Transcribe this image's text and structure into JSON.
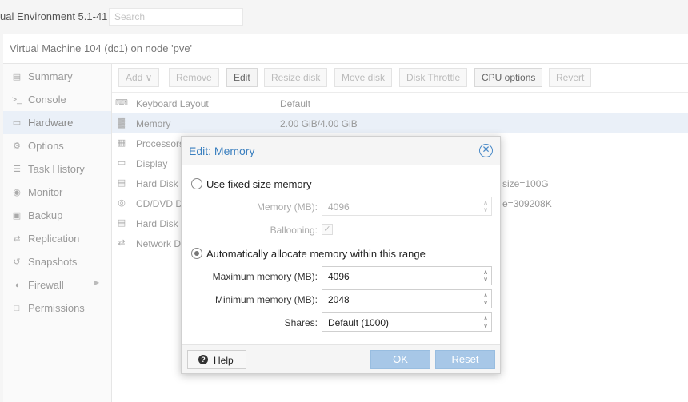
{
  "app": {
    "title": "ual Environment 5.1-41",
    "search_placeholder": "Search"
  },
  "panel": {
    "title": "Virtual Machine 104 (dc1) on node 'pve'"
  },
  "sidebar": {
    "items": [
      {
        "label": "Summary",
        "icon": "summary-icon",
        "glyph": "▤",
        "active": false
      },
      {
        "label": "Console",
        "icon": "console-icon",
        "glyph": ">_",
        "active": false
      },
      {
        "label": "Hardware",
        "icon": "monitor-icon",
        "glyph": "▭",
        "active": true
      },
      {
        "label": "Options",
        "icon": "gear-icon",
        "glyph": "⚙",
        "active": false
      },
      {
        "label": "Task History",
        "icon": "list-icon",
        "glyph": "☰",
        "active": false
      },
      {
        "label": "Monitor",
        "icon": "eye-icon",
        "glyph": "◉",
        "active": false
      },
      {
        "label": "Backup",
        "icon": "floppy-icon",
        "glyph": "▣",
        "active": false
      },
      {
        "label": "Replication",
        "icon": "retweet-icon",
        "glyph": "⇄",
        "active": false
      },
      {
        "label": "Snapshots",
        "icon": "history-icon",
        "glyph": "↺",
        "active": false
      },
      {
        "label": "Firewall",
        "icon": "shield-icon",
        "glyph": "◖",
        "active": false,
        "has_arrow": true
      },
      {
        "label": "Permissions",
        "icon": "unlock-icon",
        "glyph": "□",
        "active": false
      }
    ],
    "arrow_glyph": "▶"
  },
  "toolbar": {
    "add": "Add ∨",
    "remove": "Remove",
    "edit": "Edit",
    "resize_disk": "Resize disk",
    "move_disk": "Move disk",
    "disk_throttle": "Disk Throttle",
    "cpu_options": "CPU options",
    "revert": "Revert"
  },
  "hardware": {
    "rows": [
      {
        "name": "Keyboard Layout",
        "value": "Default",
        "tail": "",
        "icon": "keyboard-icon",
        "glyph": "⌨"
      },
      {
        "name": "Memory",
        "value": "2.00 GiB/4.00 GiB",
        "tail": "",
        "icon": "memory-icon",
        "glyph": "▓"
      },
      {
        "name": "Processors",
        "value": "",
        "tail": "",
        "icon": "cpu-icon",
        "glyph": "▦"
      },
      {
        "name": "Display",
        "value": "",
        "tail": "",
        "icon": "desktop-icon",
        "glyph": "▭"
      },
      {
        "name": "Hard Disk",
        "value": "",
        "tail": "size=100G",
        "icon": "hdd-icon",
        "glyph": "▤"
      },
      {
        "name": "CD/DVD D",
        "value": "",
        "tail": "e=309208K",
        "icon": "cdrom-icon",
        "glyph": "◎"
      },
      {
        "name": "Hard Disk",
        "value": "",
        "tail": "",
        "icon": "hdd-icon",
        "glyph": "▤"
      },
      {
        "name": "Network D",
        "value": "",
        "tail": "",
        "icon": "network-icon",
        "glyph": "⇄"
      }
    ]
  },
  "dialog": {
    "title": "Edit: Memory",
    "close_glyph": "✕",
    "fixed_option": "Use fixed size memory",
    "memory_label": "Memory (MB):",
    "memory_value": "4096",
    "ballooning_label": "Ballooning:",
    "ballooning_glyph": "✓",
    "auto_option": "Automatically allocate memory within this range",
    "max_label": "Maximum memory (MB):",
    "max_value": "4096",
    "min_label": "Minimum memory (MB):",
    "min_value": "2048",
    "shares_label": "Shares:",
    "shares_value": "Default (1000)",
    "spin_up": "∧",
    "spin_down": "∨",
    "help": "Help",
    "help_glyph": "?",
    "ok": "OK",
    "reset": "Reset",
    "selected_mode": "auto"
  }
}
